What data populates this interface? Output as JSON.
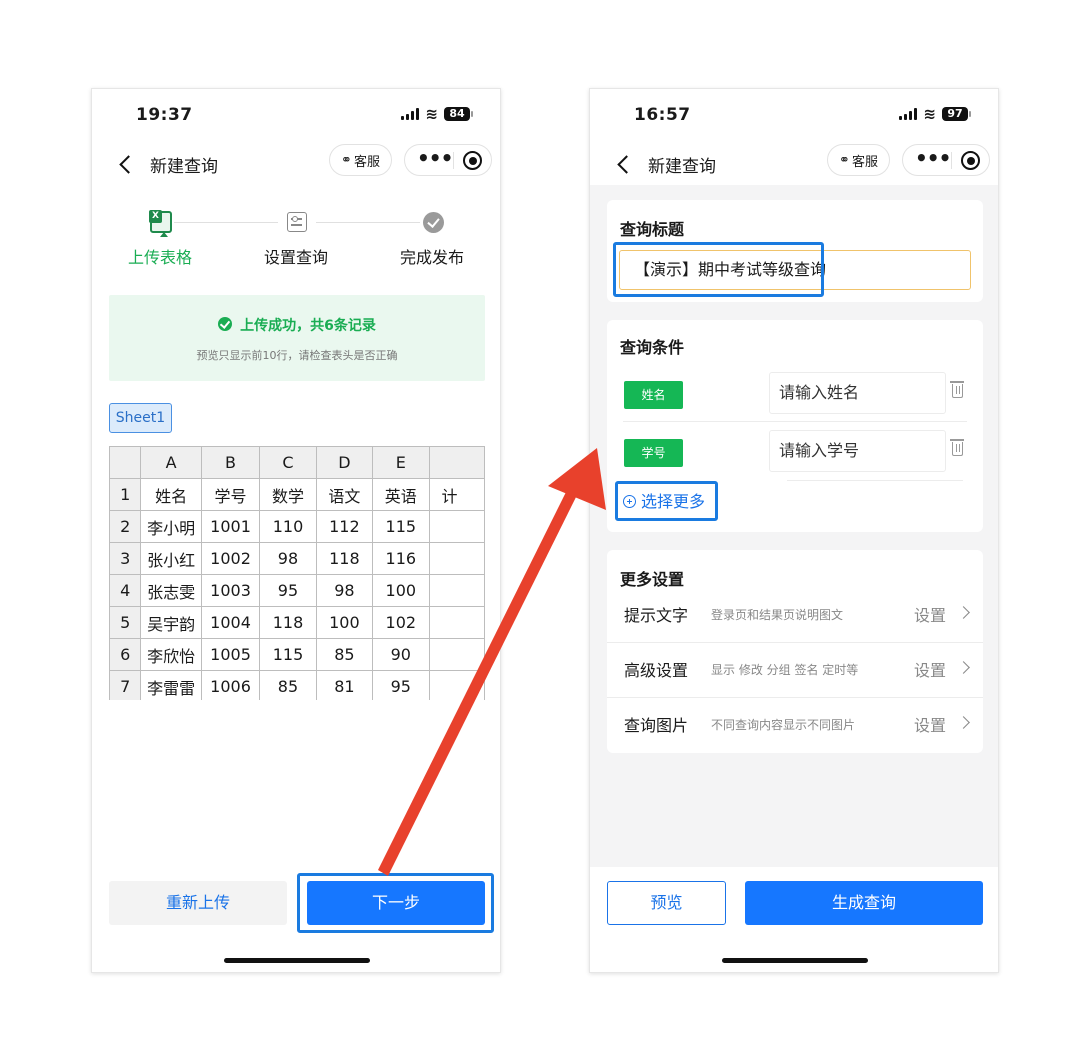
{
  "left": {
    "status": {
      "time": "19:37",
      "battery": "84"
    },
    "nav": {
      "title": "新建查询",
      "service_label": "客服",
      "more_label": "•••"
    },
    "steps": [
      {
        "label": "上传表格",
        "icon": "excel-icon"
      },
      {
        "label": "设置查询",
        "icon": "settings-icon"
      },
      {
        "label": "完成发布",
        "icon": "check-circle-icon"
      }
    ],
    "success": {
      "title": "上传成功，共6条记录",
      "subtitle": "预览只显示前10行，请检查表头是否正确"
    },
    "sheet_tab": "Sheet1",
    "grid": {
      "col_headers": [
        "A",
        "B",
        "C",
        "D",
        "E",
        ""
      ],
      "rows": [
        {
          "num": "1",
          "cells": [
            "姓名",
            "学号",
            "数学",
            "语文",
            "英语",
            "计"
          ]
        },
        {
          "num": "2",
          "cells": [
            "李小明",
            "1001",
            "110",
            "112",
            "115",
            ""
          ]
        },
        {
          "num": "3",
          "cells": [
            "张小红",
            "1002",
            "98",
            "118",
            "116",
            ""
          ]
        },
        {
          "num": "4",
          "cells": [
            "张志雯",
            "1003",
            "95",
            "98",
            "100",
            ""
          ]
        },
        {
          "num": "5",
          "cells": [
            "吴宇韵",
            "1004",
            "118",
            "100",
            "102",
            ""
          ]
        },
        {
          "num": "6",
          "cells": [
            "李欣怡",
            "1005",
            "115",
            "85",
            "90",
            ""
          ]
        },
        {
          "num": "7",
          "cells": [
            "李雷雷",
            "1006",
            "85",
            "81",
            "95",
            ""
          ]
        }
      ]
    },
    "buttons": {
      "reupload": "重新上传",
      "next": "下一步"
    }
  },
  "right": {
    "status": {
      "time": "16:57",
      "battery": "97"
    },
    "nav": {
      "title": "新建查询",
      "service_label": "客服",
      "more_label": "•••"
    },
    "title_section": {
      "heading": "查询标题",
      "value": "【演示】期中考试等级查询"
    },
    "conditions": {
      "heading": "查询条件",
      "items": [
        {
          "tag": "姓名",
          "placeholder": "请输入姓名"
        },
        {
          "tag": "学号",
          "placeholder": "请输入学号"
        }
      ],
      "more_label": "选择更多"
    },
    "more_settings": {
      "heading": "更多设置",
      "items": [
        {
          "name": "提示文字",
          "desc": "登录页和结果页说明图文",
          "action": "设置"
        },
        {
          "name": "高级设置",
          "desc": "显示 修改 分组 签名 定时等",
          "action": "设置"
        },
        {
          "name": "查询图片",
          "desc": "不同查询内容显示不同图片",
          "action": "设置"
        }
      ]
    },
    "buttons": {
      "preview": "预览",
      "generate": "生成查询"
    }
  },
  "colors": {
    "primary": "#1677ff",
    "success": "#1aad53",
    "tag_green": "#15b755",
    "highlight": "#1a7be0",
    "arrow": "#e8412c"
  }
}
